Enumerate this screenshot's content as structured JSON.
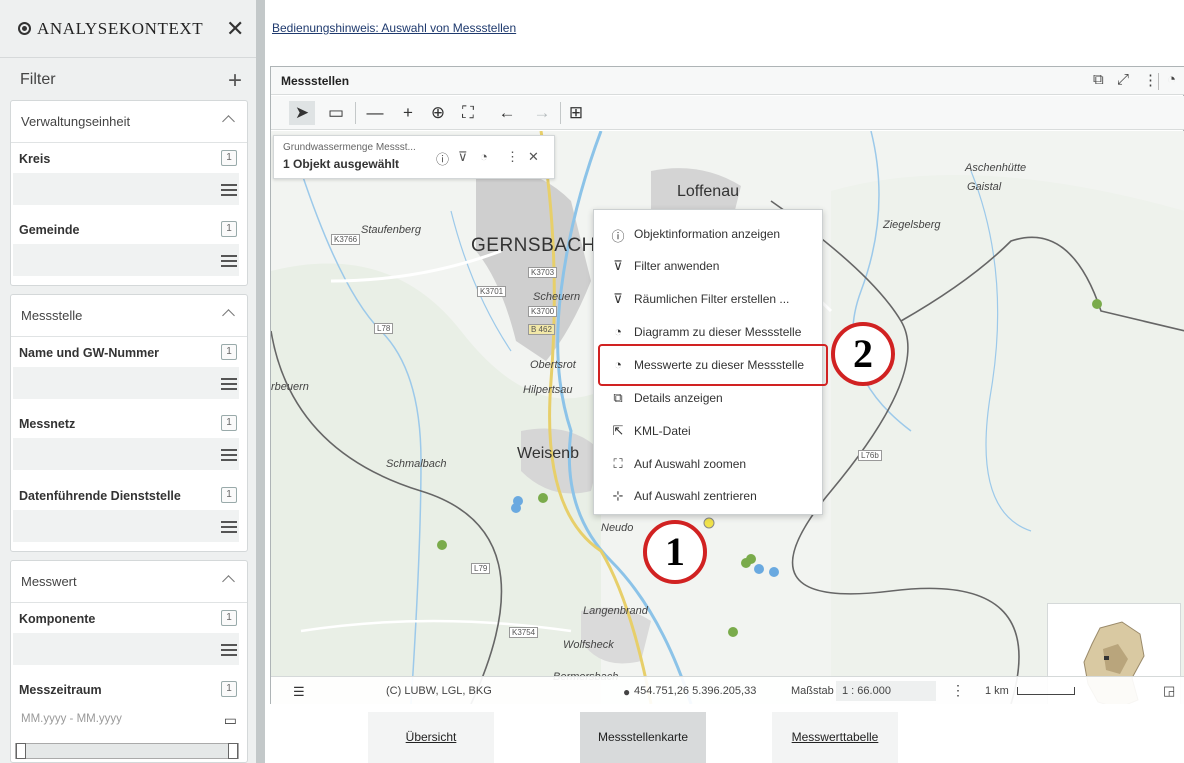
{
  "sidebar": {
    "title": "ANALYSEKONTEXT",
    "filter_label": "Filter",
    "sections": [
      {
        "title": "Verwaltungseinheit",
        "fields": [
          {
            "label": "Kreis",
            "count": "1"
          },
          {
            "label": "Gemeinde",
            "count": "1"
          }
        ]
      },
      {
        "title": "Messstelle",
        "fields": [
          {
            "label": "Name und GW-Nummer",
            "count": "1"
          },
          {
            "label": "Messnetz",
            "count": "1"
          },
          {
            "label": "Datenführende Dienststelle",
            "count": "1"
          }
        ]
      },
      {
        "title": "Messwert",
        "fields": [
          {
            "label": "Komponente",
            "count": "1"
          },
          {
            "label": "Messzeitraum",
            "count": "1"
          }
        ]
      }
    ],
    "date_placeholder": "MM.yyyy - MM.yyyy"
  },
  "hint_link": "Bedienungshinweis: Auswahl von Messstellen",
  "widget": {
    "title": "Messstellen",
    "selection": {
      "layer": "Grundwassermenge Messst...",
      "count_text": "1 Objekt ausgewählt"
    },
    "context_menu": [
      {
        "icon": "ⓘ",
        "label": "Objektinformation anzeigen"
      },
      {
        "icon": "⊽",
        "label": "Filter anwenden"
      },
      {
        "icon": "⊽",
        "label": "Räumlichen Filter erstellen ..."
      },
      {
        "icon": "◔",
        "label": "Diagramm zu dieser Messstelle"
      },
      {
        "icon": "◔",
        "label": "Messwerte zu dieser Messstelle"
      },
      {
        "icon": "⧉",
        "label": "Details anzeigen"
      },
      {
        "icon": "⇱",
        "label": "KML-Datei"
      },
      {
        "icon": "⛶",
        "label": "Auf Auswahl zoomen"
      },
      {
        "icon": "⊹",
        "label": "Auf Auswahl zentrieren"
      }
    ],
    "places": {
      "loffenau": "Loffenau",
      "gernsbach": "GERNSBACH",
      "weisenb": "Weisenb",
      "staufenberg": "Staufenberg",
      "scheuern": "Scheuern",
      "obertsrot": "Obertsrot",
      "hilpertsau": "Hilpertsau",
      "schmalbach": "Schmalbach",
      "beuern": "rbeuern",
      "aschenhutte": "Aschenhütte",
      "gaistal": "Gaistal",
      "ziegelsberg": "Ziegelsberg",
      "langenbrand": "Langenbrand",
      "wolfsheck": "Wolfsheck",
      "bermersbach": "Bermersbach",
      "neudorf": "Neudo"
    },
    "roads": {
      "k3766": "K3766",
      "k3703": "K3703",
      "k3701": "K3701",
      "k3700": "K3700",
      "b462": "B 462",
      "l78": "L78",
      "l79": "L79",
      "l76b": "L76b",
      "k3754": "K3754"
    },
    "footer": {
      "attribution": "(C) LUBW, LGL, BKG",
      "coordinates": "454.751,26  5.396.205,33",
      "scale_label": "Maßstab",
      "scale_value": "1 : 66.000",
      "scalebar": "1 km"
    }
  },
  "annotations": {
    "one": "1",
    "two": "2"
  },
  "tabs": [
    {
      "label": "Übersicht"
    },
    {
      "label": "Messstellenkarte"
    },
    {
      "label": "Messwerttabelle"
    }
  ],
  "colors": {
    "highlight_red": "#d12222",
    "point_green": "#7aab4b",
    "point_blue": "#6aa9e0"
  }
}
